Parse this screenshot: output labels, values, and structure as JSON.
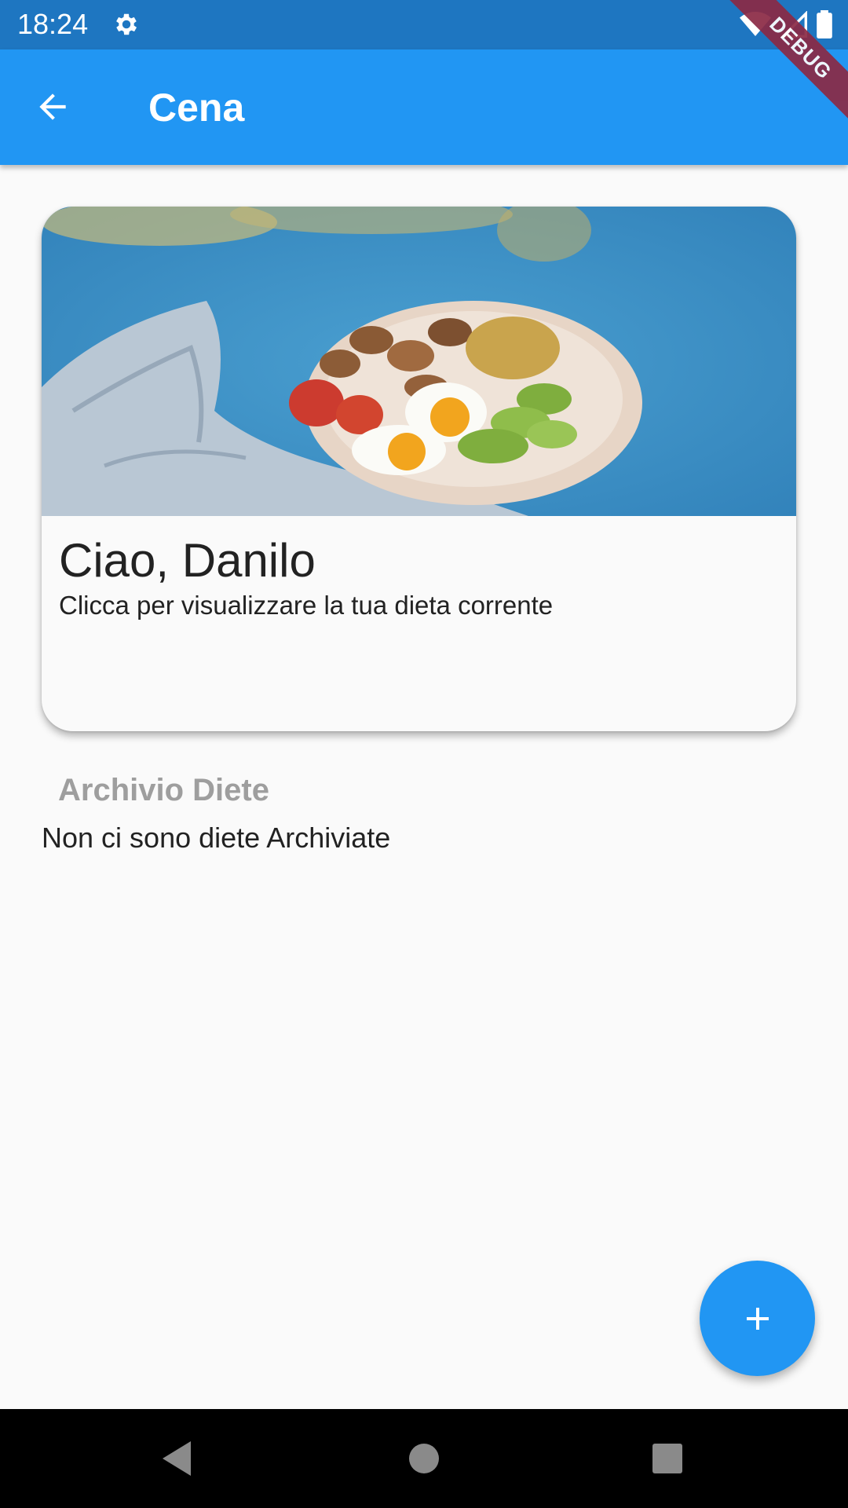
{
  "status_bar": {
    "time": "18:24",
    "icons": [
      "gear-icon",
      "wifi-icon",
      "signal-icon",
      "battery-icon"
    ]
  },
  "debug_banner": "DEBUG",
  "app_bar": {
    "title": "Cena",
    "back_icon": "arrow-back-icon",
    "color": "#2196f3"
  },
  "card": {
    "image": "food-bowl-photo",
    "title": "Ciao, Danilo",
    "subtitle": "Clicca per visualizzare la tua dieta corrente"
  },
  "archive": {
    "title": "Archivio Diete",
    "empty_text": "Non ci sono diete Archiviate"
  },
  "fab": {
    "icon": "plus-icon",
    "color": "#2196f3"
  },
  "nav_bar": {
    "buttons": [
      "back-triangle-icon",
      "home-circle-icon",
      "recents-square-icon"
    ]
  }
}
